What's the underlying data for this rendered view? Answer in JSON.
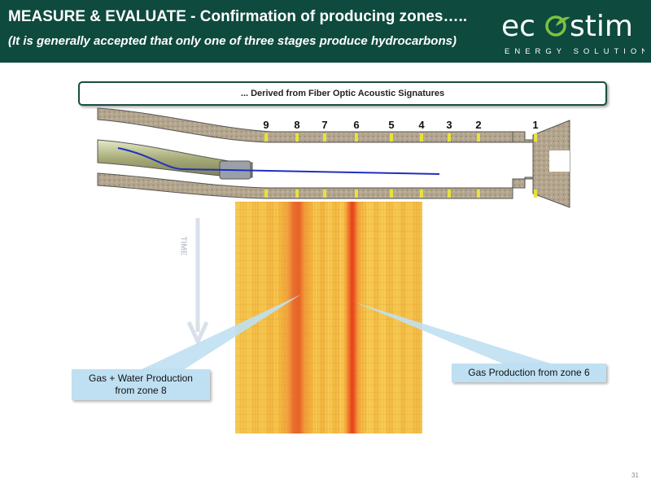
{
  "header": {
    "title": "MEASURE & EVALUATE - Confirmation of producing zones…..",
    "subtitle": "(It is generally accepted that only one of three stages produce hydrocarbons)",
    "logo": {
      "word": "ecostim",
      "tagline": "ENERGY SOLUTIONS",
      "accent_color": "#7cc242"
    }
  },
  "banner": {
    "text": "... Derived from Fiber Optic Acoustic Signatures"
  },
  "zones": [
    "9",
    "8",
    "7",
    "6",
    "5",
    "4",
    "3",
    "2",
    "1"
  ],
  "time_label": "TIME",
  "callouts": {
    "left": {
      "line1": "Gas + Water Production",
      "line2": "from zone 8"
    },
    "right": {
      "text": "Gas Production from zone 6"
    }
  },
  "page_number": "31",
  "colors": {
    "header_bg": "#0e4a3e",
    "callout_bg": "#bfe0f2",
    "fiber_line": "#1f2fbf",
    "marker": "#e8e23a",
    "heat_hot": "#e84a1e",
    "heat_base": "#f3c54a"
  }
}
